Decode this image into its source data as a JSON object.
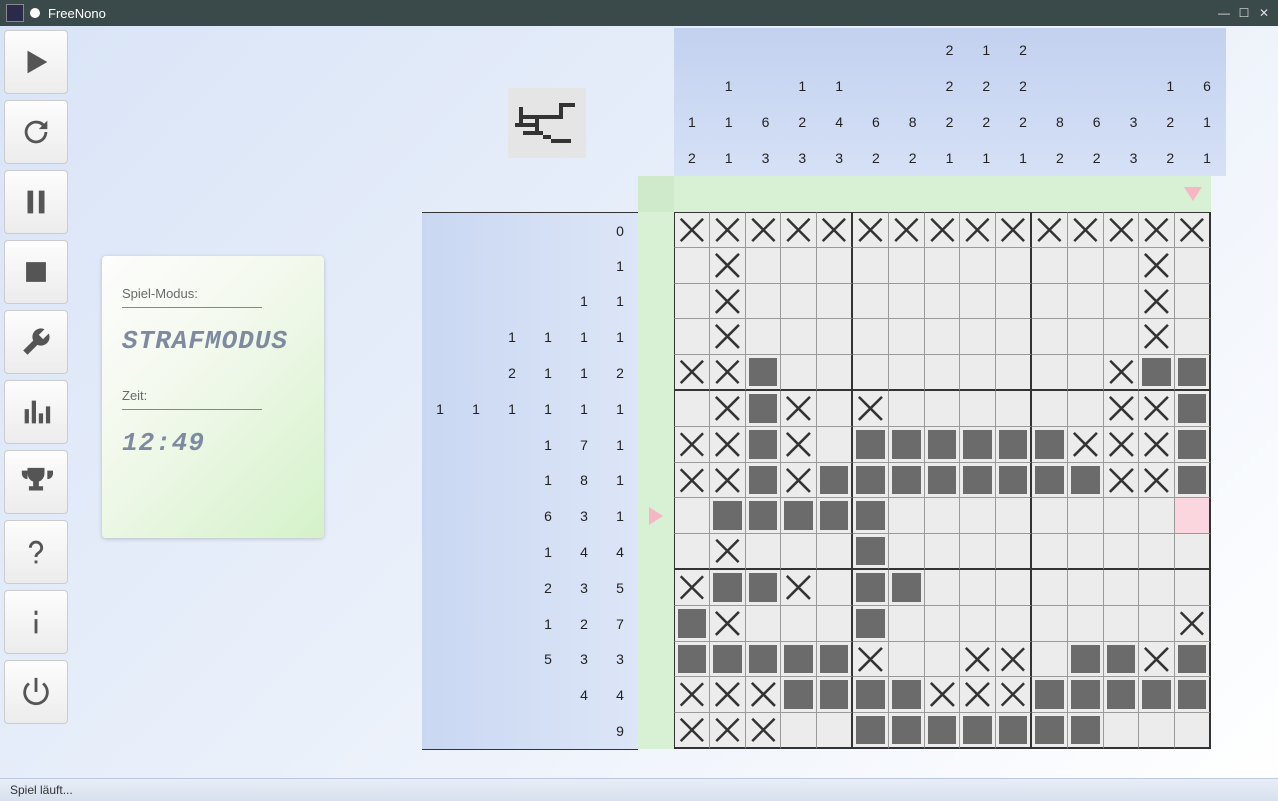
{
  "window": {
    "title": "FreeNono"
  },
  "toolbar": [
    {
      "name": "play-button",
      "icon": "play"
    },
    {
      "name": "restart-button",
      "icon": "reload"
    },
    {
      "name": "pause-button",
      "icon": "pause"
    },
    {
      "name": "stop-button",
      "icon": "stop"
    },
    {
      "name": "tools-button",
      "icon": "wrench"
    },
    {
      "name": "stats-button",
      "icon": "bars"
    },
    {
      "name": "highscore-button",
      "icon": "trophy"
    },
    {
      "name": "help-button",
      "icon": "question"
    },
    {
      "name": "info-button",
      "icon": "info"
    },
    {
      "name": "power-button",
      "icon": "power"
    }
  ],
  "info": {
    "mode_label": "Spiel-Modus:",
    "mode_value": "STRAFMODUS",
    "time_label": "Zeit:",
    "time_value": "12:49"
  },
  "status": {
    "text": "Spiel läuft..."
  },
  "puzzle": {
    "cols": 15,
    "rows": 15,
    "col_clues": [
      [
        "1",
        "2"
      ],
      [
        "1",
        "1",
        "1"
      ],
      [
        "6",
        "3"
      ],
      [
        "1",
        "2",
        "3"
      ],
      [
        "1",
        "4",
        "3"
      ],
      [
        "6",
        "2"
      ],
      [
        "8",
        "2"
      ],
      [
        "2",
        "2",
        "2",
        "1"
      ],
      [
        "1",
        "2",
        "2",
        "1"
      ],
      [
        "2",
        "2",
        "2",
        "1"
      ],
      [
        "8",
        "2"
      ],
      [
        "6",
        "2"
      ],
      [
        "3",
        "3"
      ],
      [
        "1",
        "2",
        "2"
      ],
      [
        "6",
        "1",
        "1"
      ]
    ],
    "row_clues": [
      [
        "0"
      ],
      [
        "1"
      ],
      [
        "1",
        "1"
      ],
      [
        "1",
        "1",
        "1",
        "1"
      ],
      [
        "2",
        "1",
        "1",
        "2"
      ],
      [
        "1",
        "1",
        "1",
        "1",
        "1",
        "1"
      ],
      [
        "1",
        "7",
        "1"
      ],
      [
        "1",
        "8",
        "1"
      ],
      [
        "6",
        "3",
        "1"
      ],
      [
        "1",
        "4",
        "4"
      ],
      [
        "2",
        "3",
        "5"
      ],
      [
        "1",
        "2",
        "7"
      ],
      [
        "5",
        "3",
        "3"
      ],
      [
        "4",
        "4"
      ],
      [
        "9"
      ]
    ],
    "cursor": {
      "row": 8,
      "col": 14
    },
    "grid": [
      "XXXXXXXXXXXXXXX",
      ".X...........X.",
      ".X...........X.",
      ".X...........X.",
      "XXF.........XFF",
      ".XFX.X......XXF",
      "XXFX.FFFFFFXXXF",
      "XXFXFFFFFFFFXXF",
      ".FFFFF.........",
      ".X...F.........",
      "XFFX.FF........",
      "FX...F........X",
      "FFFFFX..XX.FFXF",
      "XXXFFFFXXXFFFFF",
      "XXX..FFFFFFF..."
    ]
  }
}
